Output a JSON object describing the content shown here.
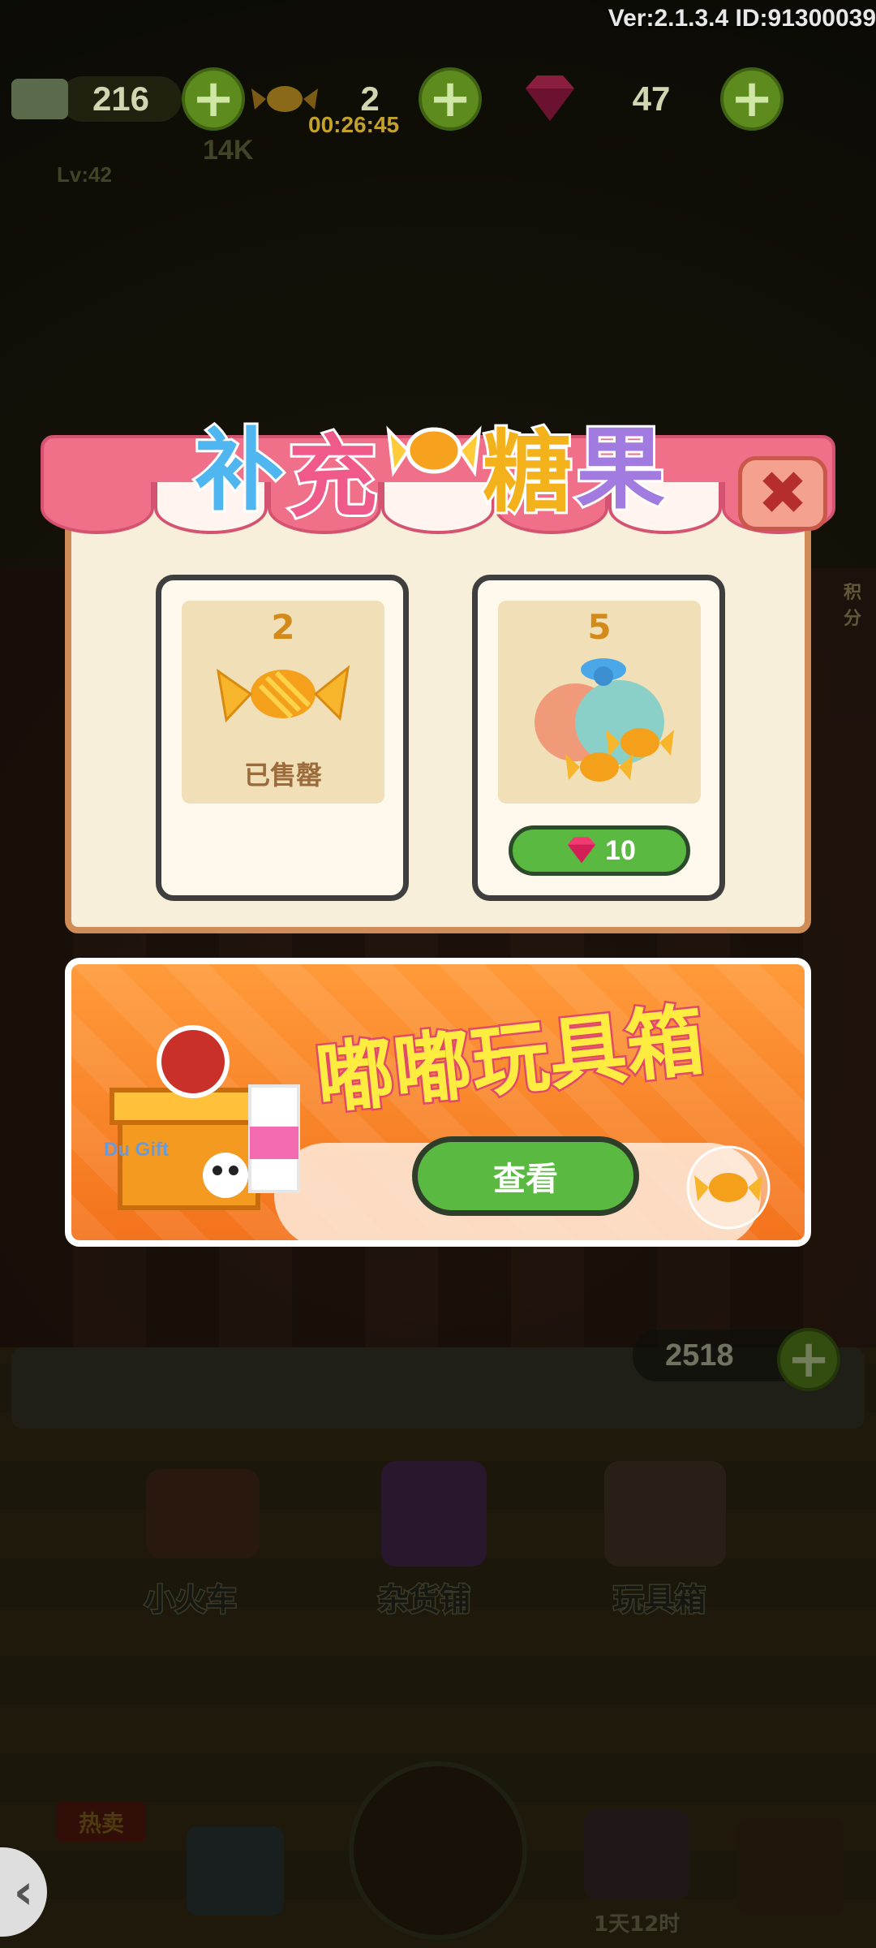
{
  "header": {
    "version": "Ver:2.1.3.4 ID:91300039",
    "tickets": "216",
    "candies": "2",
    "candy_timer": "00:26:45",
    "gems": "47",
    "player_level": "Lv:42",
    "power": "14K"
  },
  "modal": {
    "title_chars": [
      "补",
      "充",
      "糖",
      "果"
    ],
    "close_label": "✖",
    "items": [
      {
        "quantity": "2",
        "status": "已售罄",
        "icon": "candy-icon"
      },
      {
        "quantity": "5",
        "price": "10",
        "icon": "candy-bag-icon"
      }
    ]
  },
  "banner": {
    "title": "嘟嘟玩具箱",
    "button_label": "查看",
    "gift_label": "Du Gift"
  },
  "bottom": {
    "coin_counter": "2518",
    "items": [
      "小火车",
      "杂货铺",
      "玩具箱"
    ],
    "right_side_text": "积分",
    "nav_timer": "1天12时",
    "nav_tag": "热卖"
  },
  "colors": {
    "accent_green": "#5ab940",
    "awning_pink": "#f07089",
    "banner_orange": "#f3731d"
  }
}
